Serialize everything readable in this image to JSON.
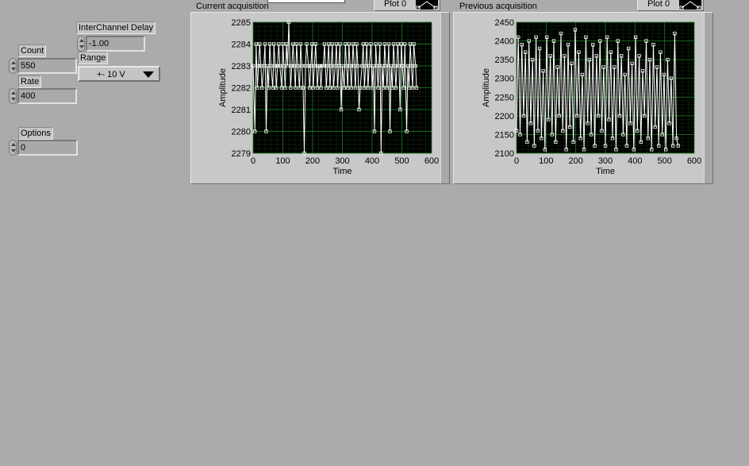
{
  "controls": {
    "count": {
      "label": "Count",
      "value": "550"
    },
    "rate": {
      "label": "Rate",
      "value": "400"
    },
    "options": {
      "label": "Options",
      "value": "0"
    },
    "interchannel_delay": {
      "label": "InterChannel Delay",
      "value": "-1.00"
    },
    "range": {
      "label": "Range",
      "value": "+- 10 V"
    }
  },
  "colors": {
    "plot_bg": "#000000",
    "grid": "#1f7a1f",
    "trace": "#ffffff",
    "panel": "#ababab"
  },
  "icons": [
    "spin-arrows-icon",
    "dropdown-arrow-icon",
    "plot-line-icon"
  ],
  "chart_data": [
    {
      "type": "line",
      "title": "Current acquisition",
      "legend": [
        "Plot 0"
      ],
      "xlabel": "Time",
      "ylabel": "Amplitude",
      "xlim": [
        0,
        600
      ],
      "ylim": [
        2279,
        2285
      ],
      "xticks": [
        "0",
        "100",
        "200",
        "300",
        "400",
        "500",
        "600"
      ],
      "yticks": [
        "2279",
        "2280",
        "2281",
        "2282",
        "2283",
        "2284",
        "2285"
      ],
      "series": [
        {
          "name": "Plot 0",
          "x": [
            0,
            6,
            10,
            14,
            18,
            22,
            26,
            30,
            36,
            40,
            44,
            48,
            52,
            56,
            60,
            66,
            70,
            74,
            78,
            82,
            86,
            90,
            96,
            100,
            104,
            108,
            112,
            116,
            120,
            126,
            130,
            134,
            138,
            142,
            146,
            150,
            156,
            160,
            164,
            168,
            172,
            176,
            180,
            186,
            190,
            194,
            198,
            202,
            206,
            210,
            216,
            220,
            224,
            228,
            232,
            236,
            240,
            246,
            250,
            254,
            258,
            262,
            266,
            270,
            276,
            280,
            284,
            288,
            292,
            296,
            300,
            306,
            310,
            314,
            318,
            322,
            326,
            330,
            336,
            340,
            344,
            348,
            352,
            356,
            360,
            366,
            370,
            374,
            378,
            382,
            386,
            390,
            396,
            400,
            404,
            408,
            412,
            416,
            420,
            426,
            430,
            434,
            438,
            442,
            446,
            450,
            456,
            460,
            464,
            468,
            472,
            476,
            480,
            486,
            490,
            494,
            498,
            502,
            506,
            510,
            516,
            520,
            524,
            528,
            532,
            536,
            540,
            546,
            549
          ],
          "y": [
            2283,
            2280,
            2284,
            2282,
            2283,
            2284,
            2283,
            2282,
            2283,
            2284,
            2280,
            2283,
            2282,
            2284,
            2283,
            2282,
            2284,
            2283,
            2282,
            2283,
            2284,
            2283,
            2282,
            2284,
            2283,
            2282,
            2284,
            2283,
            2285,
            2282,
            2283,
            2284,
            2283,
            2282,
            2284,
            2283,
            2282,
            2284,
            2283,
            2282,
            2279,
            2283,
            2284,
            2283,
            2282,
            2283,
            2284,
            2282,
            2283,
            2284,
            2282,
            2283,
            2283,
            2282,
            2283,
            2283,
            2284,
            2282,
            2283,
            2284,
            2282,
            2283,
            2284,
            2282,
            2283,
            2284,
            2282,
            2283,
            2284,
            2281,
            2283,
            2282,
            2284,
            2283,
            2282,
            2284,
            2283,
            2282,
            2284,
            2283,
            2282,
            2284,
            2283,
            2281,
            2282,
            2283,
            2284,
            2282,
            2283,
            2284,
            2282,
            2283,
            2284,
            2282,
            2283,
            2280,
            2284,
            2283,
            2282,
            2284,
            2279,
            2283,
            2282,
            2284,
            2283,
            2282,
            2284,
            2280,
            2283,
            2282,
            2284,
            2283,
            2282,
            2284,
            2283,
            2281,
            2284,
            2283,
            2282,
            2284,
            2280,
            2283,
            2282,
            2284,
            2283,
            2282,
            2284,
            2283,
            2282
          ]
        }
      ]
    },
    {
      "type": "line",
      "title": "Previous acquisition",
      "legend": [
        "Plot 0"
      ],
      "xlabel": "Time",
      "ylabel": "Amplitude",
      "xlim": [
        0,
        600
      ],
      "ylim": [
        2100,
        2450
      ],
      "xticks": [
        "0",
        "100",
        "200",
        "300",
        "400",
        "500",
        "600"
      ],
      "yticks": [
        "2100",
        "2150",
        "2200",
        "2250",
        "2300",
        "2350",
        "2400",
        "2450"
      ],
      "series": [
        {
          "name": "Plot 0",
          "x": [
            0,
            6,
            12,
            18,
            24,
            30,
            36,
            42,
            48,
            54,
            60,
            66,
            72,
            78,
            84,
            90,
            96,
            102,
            108,
            114,
            120,
            126,
            132,
            138,
            144,
            150,
            156,
            162,
            168,
            174,
            180,
            186,
            192,
            198,
            204,
            210,
            216,
            222,
            228,
            234,
            240,
            246,
            252,
            258,
            264,
            270,
            276,
            282,
            288,
            294,
            300,
            306,
            312,
            318,
            324,
            330,
            336,
            342,
            348,
            354,
            360,
            366,
            372,
            378,
            384,
            390,
            396,
            402,
            408,
            414,
            420,
            426,
            432,
            438,
            444,
            450,
            456,
            462,
            468,
            474,
            480,
            486,
            492,
            498,
            504,
            510,
            516,
            522,
            528,
            534,
            540,
            546
          ],
          "y": [
            2160,
            2410,
            2150,
            2390,
            2200,
            2370,
            2130,
            2400,
            2180,
            2350,
            2120,
            2410,
            2160,
            2380,
            2140,
            2320,
            2110,
            2410,
            2190,
            2360,
            2150,
            2400,
            2130,
            2330,
            2200,
            2420,
            2160,
            2360,
            2110,
            2390,
            2170,
            2340,
            2130,
            2430,
            2200,
            2370,
            2140,
            2310,
            2110,
            2410,
            2180,
            2350,
            2150,
            2390,
            2120,
            2360,
            2200,
            2400,
            2160,
            2330,
            2120,
            2410,
            2190,
            2370,
            2140,
            2330,
            2110,
            2400,
            2200,
            2360,
            2150,
            2310,
            2120,
            2380,
            2180,
            2340,
            2110,
            2410,
            2160,
            2360,
            2130,
            2320,
            2200,
            2400,
            2140,
            2350,
            2110,
            2390,
            2170,
            2330,
            2120,
            2370,
            2150,
            2310,
            2110,
            2350,
            2180,
            2300,
            2120,
            2420,
            2140,
            2120
          ]
        }
      ]
    }
  ]
}
